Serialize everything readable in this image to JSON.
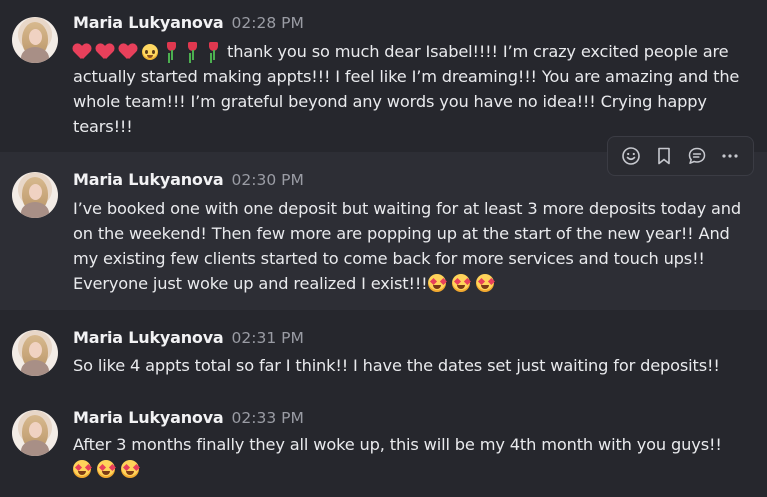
{
  "messages": [
    {
      "author": "Maria Lukyanova",
      "time": "02:28 PM",
      "emoji_prefix": [
        "red-heart",
        "red-heart",
        "red-heart",
        "pleading-face",
        "tulip",
        "tulip",
        "tulip"
      ],
      "text": "thank you so much dear Isabel!!!! I’m crazy excited people are actually started making appts!!! I feel like I’m dreaming!!! You are amazing and the whole team!!! I’m grateful beyond any words you have no idea!!! Crying happy tears!!!",
      "emoji_suffix": []
    },
    {
      "author": "Maria Lukyanova",
      "time": "02:30 PM",
      "emoji_prefix": [],
      "text": "I’ve booked one with one deposit but waiting for at least 3 more deposits today and on the weekend! Then few more are popping up at the start of the new year!! And my existing few clients started to come back for more services and touch ups!! Everyone just woke up and realized I exist!!!",
      "emoji_suffix": [
        "star-struck",
        "star-struck",
        "star-struck"
      ]
    },
    {
      "author": "Maria Lukyanova",
      "time": "02:31 PM",
      "emoji_prefix": [],
      "text": "So like 4 appts total so far I think!! I have the dates set just waiting for deposits!!",
      "emoji_suffix": []
    },
    {
      "author": "Maria Lukyanova",
      "time": "02:33 PM",
      "emoji_prefix": [],
      "text": "After 3 months finally they all woke up, this will be my 4th month with you guys!!",
      "emoji_suffix": [
        "star-struck",
        "star-struck",
        "star-struck"
      ]
    }
  ],
  "hover_toolbar": {
    "actions": [
      "emoji-reaction-icon",
      "bookmark-icon",
      "reply-thread-icon",
      "more-options-icon"
    ]
  },
  "colors": {
    "background": "#26272d",
    "hover_background": "#2d2e35",
    "author": "#f2f2f4",
    "timestamp": "#9a9ca4",
    "text": "#e9eaed"
  }
}
